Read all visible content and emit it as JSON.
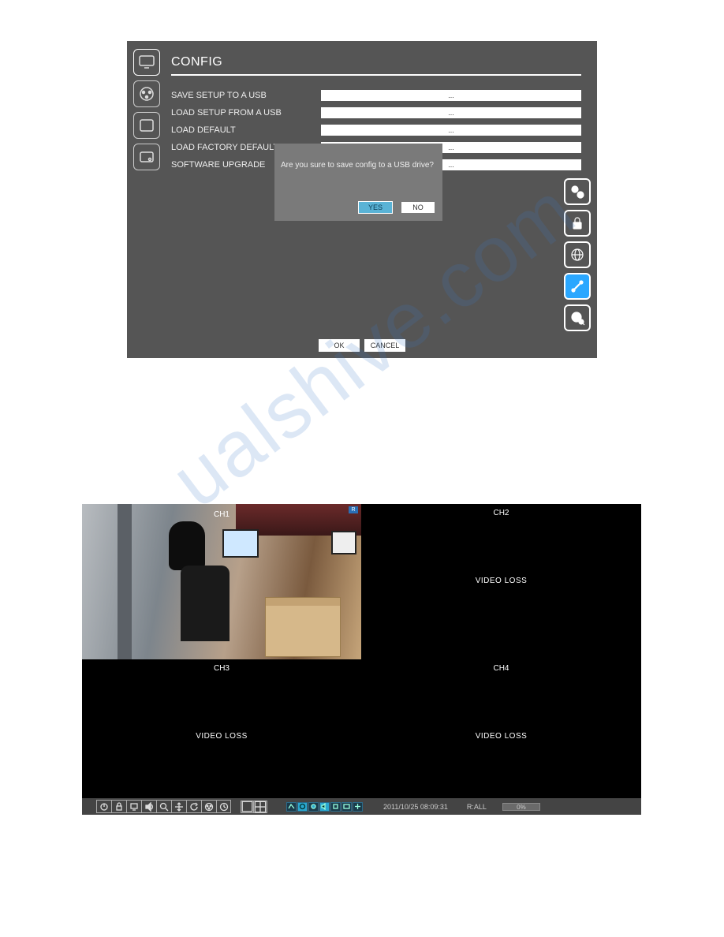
{
  "watermark": "ualshive.com",
  "config": {
    "title": "CONFIG",
    "rows": [
      {
        "label": "SAVE SETUP TO A USB",
        "value": "..."
      },
      {
        "label": "LOAD SETUP FROM A USB",
        "value": "..."
      },
      {
        "label": "LOAD DEFAULT",
        "value": "..."
      },
      {
        "label": "LOAD FACTORY DEFAULT",
        "value": "..."
      },
      {
        "label": "SOFTWARE UPGRADE",
        "value": "..."
      }
    ],
    "ok_label": "OK",
    "cancel_label": "CANCEL",
    "left_icons": [
      "monitor-icon",
      "reel-icon",
      "keypad-icon",
      "hdd-icon"
    ],
    "right_icons": [
      "gears-icon",
      "lock-icon",
      "globe-icon",
      "tools-icon",
      "reel-search-icon"
    ],
    "right_active_index": 3
  },
  "dialog": {
    "message": "Are you sure to save config to a USB drive?",
    "yes_label": "YES",
    "no_label": "NO"
  },
  "live": {
    "channels": [
      {
        "label": "CH1",
        "status": ""
      },
      {
        "label": "CH2",
        "status": "VIDEO LOSS"
      },
      {
        "label": "CH3",
        "status": "VIDEO LOSS"
      },
      {
        "label": "CH4",
        "status": "VIDEO LOSS"
      }
    ],
    "rec_indicator": "R",
    "statusbar": {
      "timestamp": "2011/10/25 08:09:31",
      "rec_text": "R:ALL",
      "progress": "0%",
      "main_buttons": [
        "power-icon",
        "lock-icon",
        "screen-icon",
        "volume-icon",
        "search-icon",
        "move-icon",
        "refresh-icon",
        "reel-icon",
        "clock-icon"
      ],
      "layout_buttons": [
        "layout-1-icon",
        "layout-4-icon"
      ],
      "indicators": [
        "net-icon",
        "motion-icon",
        "rec-icon",
        "audio-icon",
        "alarm-icon",
        "hdd-icon",
        "ptz-icon"
      ]
    }
  }
}
